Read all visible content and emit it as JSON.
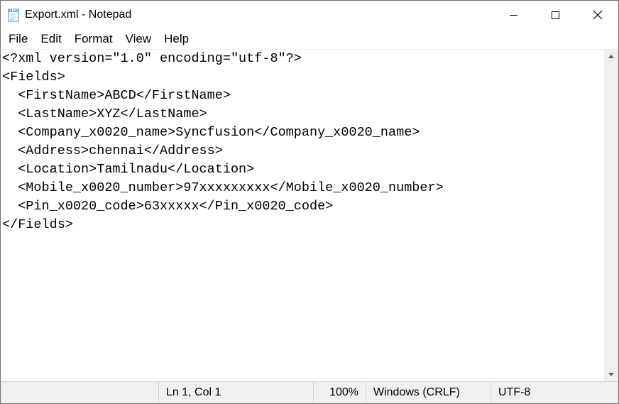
{
  "window": {
    "title": "Export.xml - Notepad"
  },
  "menu": {
    "file": "File",
    "edit": "Edit",
    "format": "Format",
    "view": "View",
    "help": "Help"
  },
  "content": "<?xml version=\"1.0\" encoding=\"utf-8\"?>\n<Fields>\n  <FirstName>ABCD</FirstName>\n  <LastName>XYZ</LastName>\n  <Company_x0020_name>Syncfusion</Company_x0020_name>\n  <Address>chennai</Address>\n  <Location>Tamilnadu</Location>\n  <Mobile_x0020_number>97xxxxxxxxx</Mobile_x0020_number>\n  <Pin_x0020_code>63xxxxx</Pin_x0020_code>\n</Fields>",
  "status": {
    "position": "Ln 1, Col 1",
    "zoom": "100%",
    "line_ending": "Windows (CRLF)",
    "encoding": "UTF-8"
  }
}
